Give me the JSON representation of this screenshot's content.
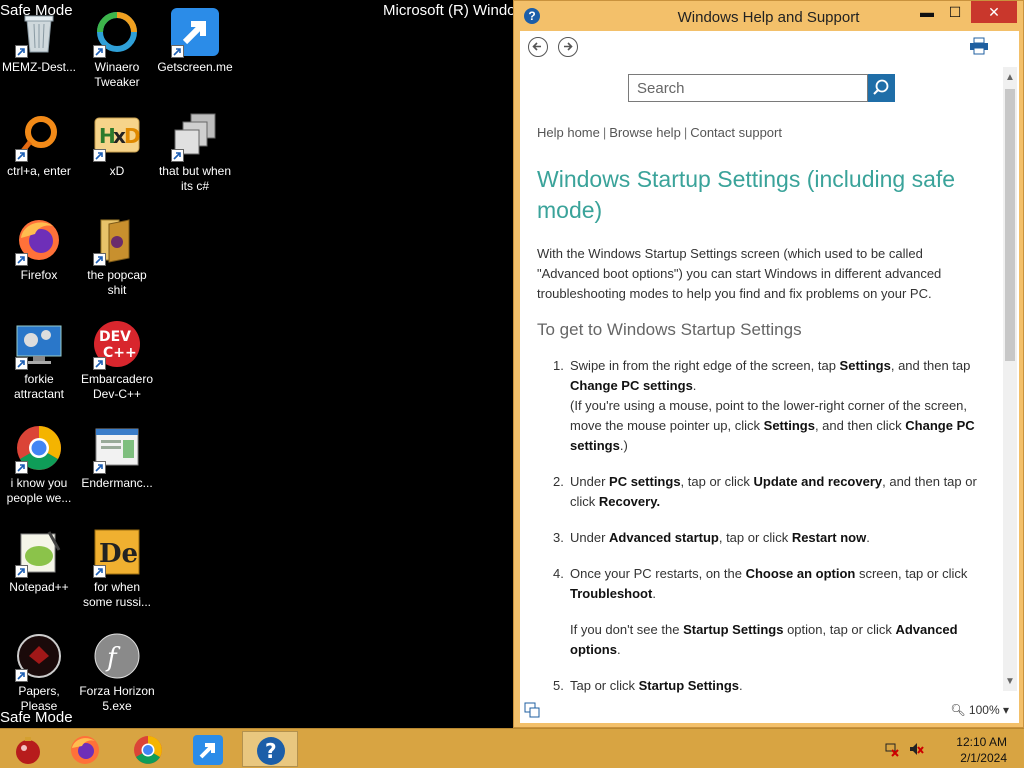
{
  "desktop": {
    "safe_mode_top": "Safe Mode",
    "safe_mode_bottom": "Safe Mode",
    "os_title": "Microsoft (R) Windo",
    "icons": [
      {
        "label": "MEMZ-Dest...",
        "icon": "recycle-bin-icon"
      },
      {
        "label": "Winaero Tweaker",
        "icon": "winaero-icon"
      },
      {
        "label": "Getscreen.me",
        "icon": "getscreen-icon"
      },
      {
        "label": "ctrl+a, enter",
        "icon": "ring-icon"
      },
      {
        "label": "xD",
        "icon": "hxd-icon"
      },
      {
        "label": "that but when its c#",
        "icon": "stacked-windows-icon"
      },
      {
        "label": "Firefox",
        "icon": "firefox-icon"
      },
      {
        "label": "the popcap shit",
        "icon": "folder-icon"
      },
      {
        "label": "forkie attractant",
        "icon": "monitor-gear-icon"
      },
      {
        "label": "Embarcadero Dev-C++",
        "icon": "devcpp-icon"
      },
      {
        "label": "i know you people we...",
        "icon": "chrome-icon"
      },
      {
        "label": "Endermanc...",
        "icon": "window-app-icon"
      },
      {
        "label": "Notepad++",
        "icon": "notepadpp-icon"
      },
      {
        "label": "for when some russi...",
        "icon": "de-icon"
      },
      {
        "label": "Papers, Please",
        "icon": "papers-please-icon"
      },
      {
        "label": "Forza Horizon 5.exe",
        "icon": "flash-icon"
      }
    ]
  },
  "help_window": {
    "title": "Windows Help and Support",
    "buttons": {
      "minimize": "▬",
      "maximize": "☐",
      "close": "✕"
    },
    "search_placeholder": "Search",
    "links": {
      "home": "Help home",
      "browse": "Browse help",
      "contact": "Contact support"
    },
    "page_title": "Windows Startup Settings (including safe mode)",
    "intro": "With the Windows Startup Settings screen (which used to be called \"Advanced boot options\") you can start Windows in different advanced troubleshooting modes to help you find and fix problems on your PC.",
    "section_heading": "To get to Windows Startup Settings",
    "steps": [
      {
        "num": "1.",
        "parts": [
          "Swipe in from the right edge of the screen, tap ",
          "Settings",
          ", and then tap ",
          "Change PC settings",
          ".",
          "(If you're using a mouse, point to the lower-right corner of the screen, move the mouse pointer up, click ",
          "Settings",
          ", and then click ",
          "Change PC settings",
          ".)"
        ]
      },
      {
        "num": "2.",
        "parts": [
          "Under ",
          "PC settings",
          ", tap or click ",
          "Update and recovery",
          ", and then tap or click ",
          "Recovery."
        ]
      },
      {
        "num": "3.",
        "parts": [
          "Under ",
          "Advanced startup",
          ", tap or click ",
          "Restart now",
          "."
        ]
      },
      {
        "num": "4.",
        "parts": [
          "Once your PC restarts, on the ",
          "Choose an option",
          " screen, tap or click ",
          "Troubleshoot",
          "."
        ],
        "note_parts": [
          "If you don't see the ",
          "Startup Settings",
          " option, tap or click ",
          "Advanced options",
          "."
        ]
      },
      {
        "num": "5.",
        "parts": [
          "Tap or click ",
          "Startup Settings",
          "."
        ]
      }
    ],
    "zoom": "100%"
  },
  "taskbar": {
    "items": [
      "ornament-icon",
      "firefox-icon",
      "chrome-icon",
      "getscreen-icon",
      "help-icon"
    ],
    "clock_time": "12:10 AM",
    "clock_date": "2/1/2024"
  }
}
